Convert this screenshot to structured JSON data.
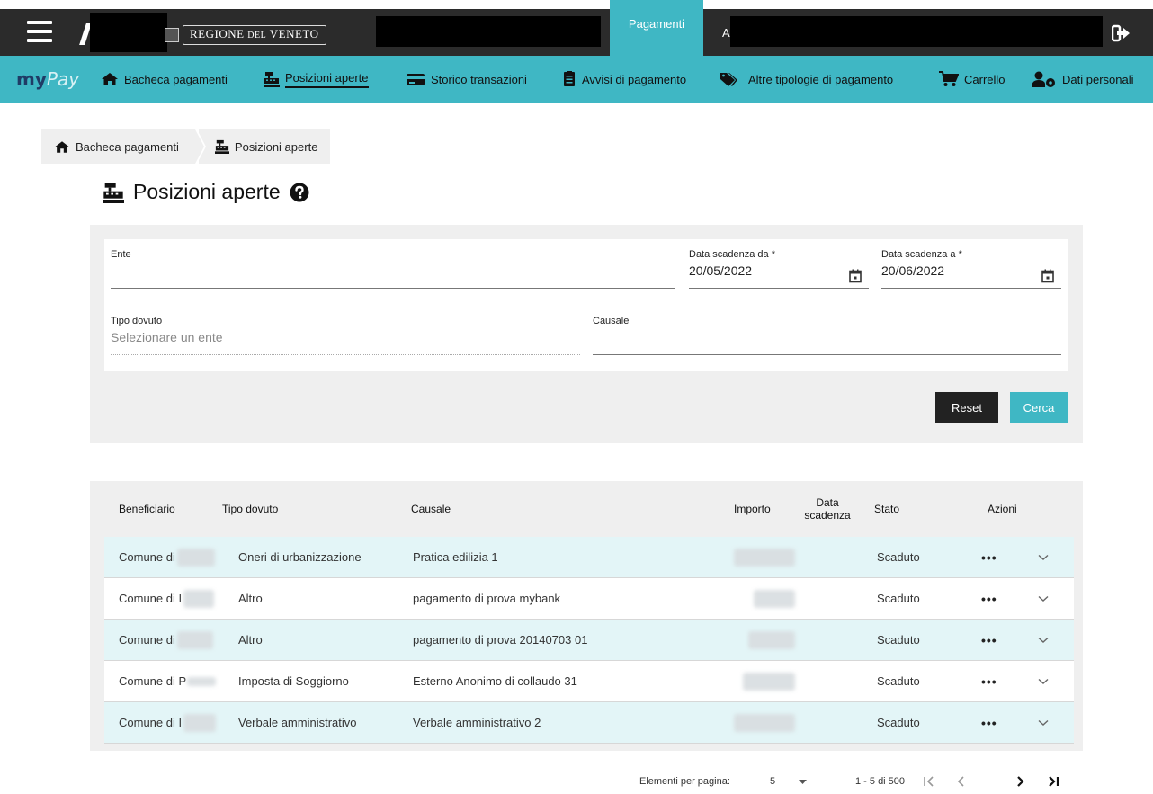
{
  "topbar": {
    "region_name_main": "REGIONE ",
    "region_name_small": "DEL",
    "region_name_end": " VENETO",
    "active_tab": "Pagamenti",
    "partial_tab": "A"
  },
  "nav": {
    "brand_my": "my",
    "brand_pay": "Pay",
    "items": [
      {
        "label": "Bacheca pagamenti",
        "icon": "home-icon"
      },
      {
        "label": "Posizioni aperte",
        "icon": "cash-register-icon",
        "active": true
      },
      {
        "label": "Storico transazioni",
        "icon": "credit-card-icon"
      },
      {
        "label": "Avvisi di pagamento",
        "icon": "document-icon"
      },
      {
        "label": "Altre tipologie di pagamento",
        "icon": "tags-icon"
      },
      {
        "label": "Carrello",
        "icon": "cart-icon"
      },
      {
        "label": "Dati personali",
        "icon": "user-cog-icon"
      }
    ]
  },
  "breadcrumb": [
    "Bacheca pagamenti",
    "Posizioni aperte"
  ],
  "page": {
    "title": "Posizioni aperte"
  },
  "filters": {
    "ente_label": "Ente",
    "ente_value": "",
    "data_da_label": "Data scadenza da *",
    "data_da_value": "20/05/2022",
    "data_a_label": "Data scadenza a *",
    "data_a_value": "20/06/2022",
    "tipo_label": "Tipo dovuto",
    "tipo_placeholder": "Selezionare un ente",
    "causale_label": "Causale",
    "causale_value": "",
    "reset_label": "Reset",
    "cerca_label": "Cerca"
  },
  "table": {
    "headers": {
      "beneficiario": "Beneficiario",
      "tipo": "Tipo dovuto",
      "causale": "Causale",
      "importo": "Importo",
      "data_1": "Data",
      "data_2": "scadenza",
      "stato": "Stato",
      "azioni": "Azioni"
    },
    "rows": [
      {
        "beneficiario": "Comune di",
        "tipo": "Oneri di urbanizzazione",
        "causale": "Pratica edilizia 1",
        "stato": "Scaduto",
        "azioni": "•••"
      },
      {
        "beneficiario": "Comune di I",
        "tipo": "Altro",
        "causale": "pagamento di prova mybank",
        "stato": "Scaduto",
        "azioni": "•••"
      },
      {
        "beneficiario": "Comune di",
        "tipo": "Altro",
        "causale": "pagamento di prova 20140703 01",
        "stato": "Scaduto",
        "azioni": "•••"
      },
      {
        "beneficiario": "Comune di P",
        "tipo": "Imposta di Soggiorno",
        "causale": "Esterno Anonimo di collaudo 31",
        "stato": "Scaduto",
        "azioni": "•••"
      },
      {
        "beneficiario": "Comune di I",
        "tipo": "Verbale amministrativo",
        "causale": "Verbale amministrativo 2",
        "stato": "Scaduto",
        "azioni": "•••"
      }
    ]
  },
  "pagination": {
    "per_page_label": "Elementi per pagina:",
    "per_page_value": "5",
    "range": "1 - 5 di 500"
  }
}
